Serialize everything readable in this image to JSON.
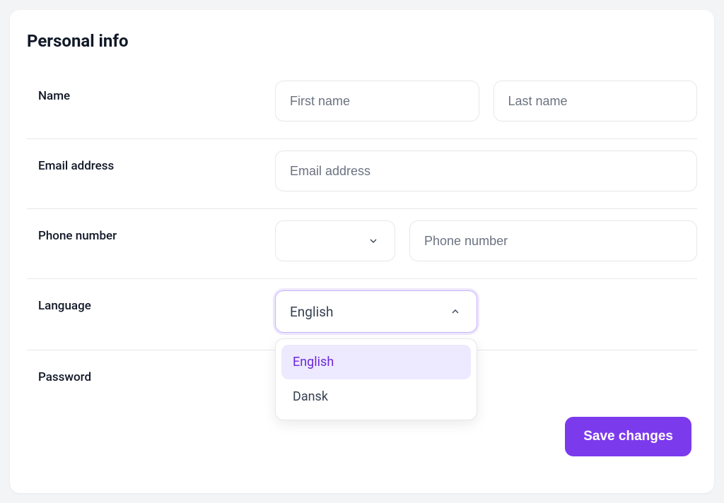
{
  "title": "Personal info",
  "rows": {
    "name": {
      "label": "Name",
      "first_placeholder": "First name",
      "last_placeholder": "Last name"
    },
    "email": {
      "label": "Email address",
      "placeholder": "Email address"
    },
    "phone": {
      "label": "Phone number",
      "placeholder": "Phone number"
    },
    "language": {
      "label": "Language",
      "selected": "English",
      "options": [
        "English",
        "Dansk"
      ]
    },
    "password": {
      "label": "Password"
    }
  },
  "actions": {
    "save": "Save changes"
  }
}
